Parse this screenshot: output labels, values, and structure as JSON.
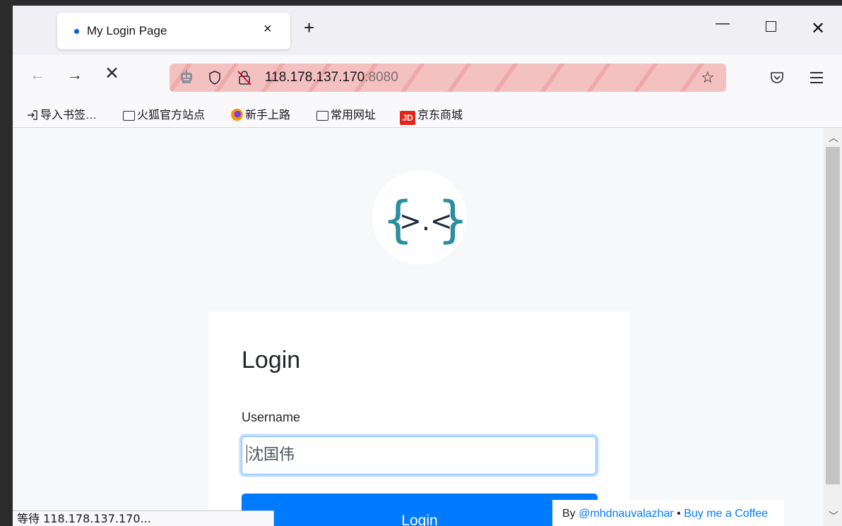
{
  "browser": {
    "tab": {
      "title": "My Login Page",
      "close": "×"
    },
    "new_tab": "+",
    "window_controls": {
      "minimize": "—",
      "close": "✕"
    },
    "nav": {
      "back": "←",
      "forward": "→",
      "stop": "✕"
    },
    "url": {
      "host": "118.178.137.170",
      "port": ":8080"
    },
    "star": "☆",
    "bookmarks": [
      {
        "label": "导入书签…",
        "icon": "import-icon"
      },
      {
        "label": "火狐官方站点",
        "icon": "folder-icon"
      },
      {
        "label": "新手上路",
        "icon": "firefox-icon"
      },
      {
        "label": "常用网址",
        "icon": "folder-icon"
      },
      {
        "label": "京东商城",
        "icon": "jd-icon"
      }
    ],
    "jd_badge": "JD",
    "status": "等待 118.178.137.170..."
  },
  "page": {
    "logo": {
      "left": "{",
      "middle": ">.<",
      "right": "}",
      "color": "#2a8ea0"
    },
    "login_card": {
      "title": "Login",
      "username_label": "Username",
      "username_value": "沈国伟",
      "submit_label": "Login"
    },
    "credit": {
      "prefix": "By",
      "author": "@mhdnauvalazhar",
      "separator": "•",
      "coffee": "Buy me a Coffee"
    }
  },
  "colors": {
    "accent": "#007bff",
    "insecure_bar": "#f4c1c1"
  }
}
